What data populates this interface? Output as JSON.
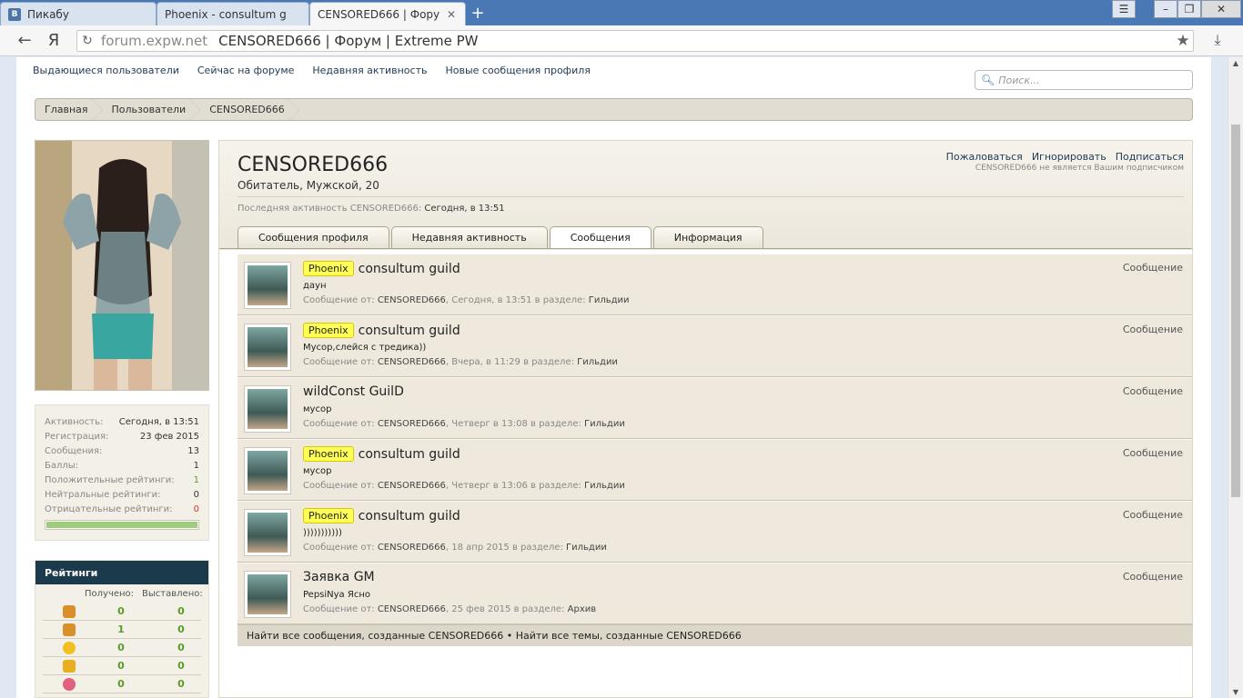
{
  "browser": {
    "tabs": [
      {
        "title": "Пикабу",
        "favicon": "В",
        "active": false
      },
      {
        "title": "Phoenix - consultum g",
        "active": false
      },
      {
        "title": "CENSORED666 | Фору",
        "active": true
      }
    ],
    "tab_close": "✕",
    "new_tab": "+",
    "address": {
      "logo": "Я",
      "domain": "forum.expw.net",
      "title": "CENSORED666 | Форум | Extreme PW"
    }
  },
  "subnav": {
    "items": [
      "Выдающиеся пользователи",
      "Сейчас на форуме",
      "Недавняя активность",
      "Новые сообщения профиля"
    ]
  },
  "search": {
    "placeholder": "Поиск..."
  },
  "breadcrumb": [
    "Главная",
    "Пользователи",
    "CENSORED666"
  ],
  "stats": [
    {
      "k": "Активность:",
      "v": "Сегодня, в 13:51",
      "cls": ""
    },
    {
      "k": "Регистрация:",
      "v": "23 фев 2015",
      "cls": ""
    },
    {
      "k": "Сообщения:",
      "v": "13",
      "cls": ""
    },
    {
      "k": "Баллы:",
      "v": "1",
      "cls": ""
    },
    {
      "k": "Положительные рейтинги:",
      "v": "1",
      "cls": "green"
    },
    {
      "k": "Нейтральные рейтинги:",
      "v": "0",
      "cls": ""
    },
    {
      "k": "Отрицательные рейтинги:",
      "v": "0",
      "cls": "red"
    }
  ],
  "reputation_fill": 1.0,
  "ratings": {
    "title": "Рейтинги",
    "col_received": "Получено:",
    "col_given": "Выставлено:",
    "rows": [
      {
        "icon": "thumbs-up-icon",
        "color": "#d9902a",
        "received": "0",
        "given": "0"
      },
      {
        "icon": "thumbs-down-icon",
        "color": "#d9902a",
        "received": "1",
        "given": "0"
      },
      {
        "icon": "smiley-icon",
        "color": "#f0c020",
        "received": "0",
        "given": "0"
      },
      {
        "icon": "star-icon",
        "color": "#e8b020",
        "received": "0",
        "given": "0"
      },
      {
        "icon": "heart-icon",
        "color": "#e06080",
        "received": "0",
        "given": "0"
      }
    ]
  },
  "profile": {
    "username": "CENSORED666",
    "subtitle": "Обитатель, Мужской, 20",
    "actions": [
      "Пожаловаться",
      "Игнорировать",
      "Подписаться"
    ],
    "not_subscribed": "CENSORED666 не является Вашим подписчиком",
    "last_activity_label": "Последняя активность CENSORED666:",
    "last_activity_value": "Сегодня, в 13:51"
  },
  "tabs": [
    {
      "label": "Сообщения профиля",
      "active": false
    },
    {
      "label": "Недавняя активность",
      "active": false
    },
    {
      "label": "Сообщения",
      "active": true
    },
    {
      "label": "Информация",
      "active": false
    }
  ],
  "messages": [
    {
      "prefix": "Phoenix",
      "title": "consultum guild",
      "snippet": "даун",
      "meta_prefix": "Сообщение от:",
      "author": "CENSORED666",
      "time": "Сегодня, в 13:51",
      "in": "в разделе:",
      "section": "Гильдии",
      "type": "Сообщение"
    },
    {
      "prefix": "Phoenix",
      "title": "consultum guild",
      "snippet": "Мусор,слейся с тредика))",
      "meta_prefix": "Сообщение от:",
      "author": "CENSORED666",
      "time": "Вчера, в 11:29",
      "in": "в разделе:",
      "section": "Гильдии",
      "type": "Сообщение"
    },
    {
      "prefix": "",
      "title": "wildConst GuilD",
      "snippet": "мусор",
      "meta_prefix": "Сообщение от:",
      "author": "CENSORED666",
      "time": "Четверг в 13:08",
      "in": "в разделе:",
      "section": "Гильдии",
      "type": "Сообщение"
    },
    {
      "prefix": "Phoenix",
      "title": "consultum guild",
      "snippet": "мусор",
      "meta_prefix": "Сообщение от:",
      "author": "CENSORED666",
      "time": "Четверг в 13:06",
      "in": "в разделе:",
      "section": "Гильдии",
      "type": "Сообщение"
    },
    {
      "prefix": "Phoenix",
      "title": "consultum guild",
      "snippet": ")))))))))))",
      "meta_prefix": "Сообщение от:",
      "author": "CENSORED666",
      "time": "18 апр 2015",
      "in": "в разделе:",
      "section": "Гильдии",
      "type": "Сообщение"
    },
    {
      "prefix": "",
      "title": "Заявка GM",
      "snippet": "PepsiNya Ясно",
      "meta_prefix": "Сообщение от:",
      "author": "CENSORED666",
      "time": "25 фев 2015",
      "in": "в разделе:",
      "section": "Архив",
      "type": "Сообщение"
    }
  ],
  "find_bar": {
    "find_posts": "Найти все сообщения, созданные CENSORED666",
    "separator": "•",
    "find_threads": "Найти все темы, созданные CENSORED666"
  }
}
